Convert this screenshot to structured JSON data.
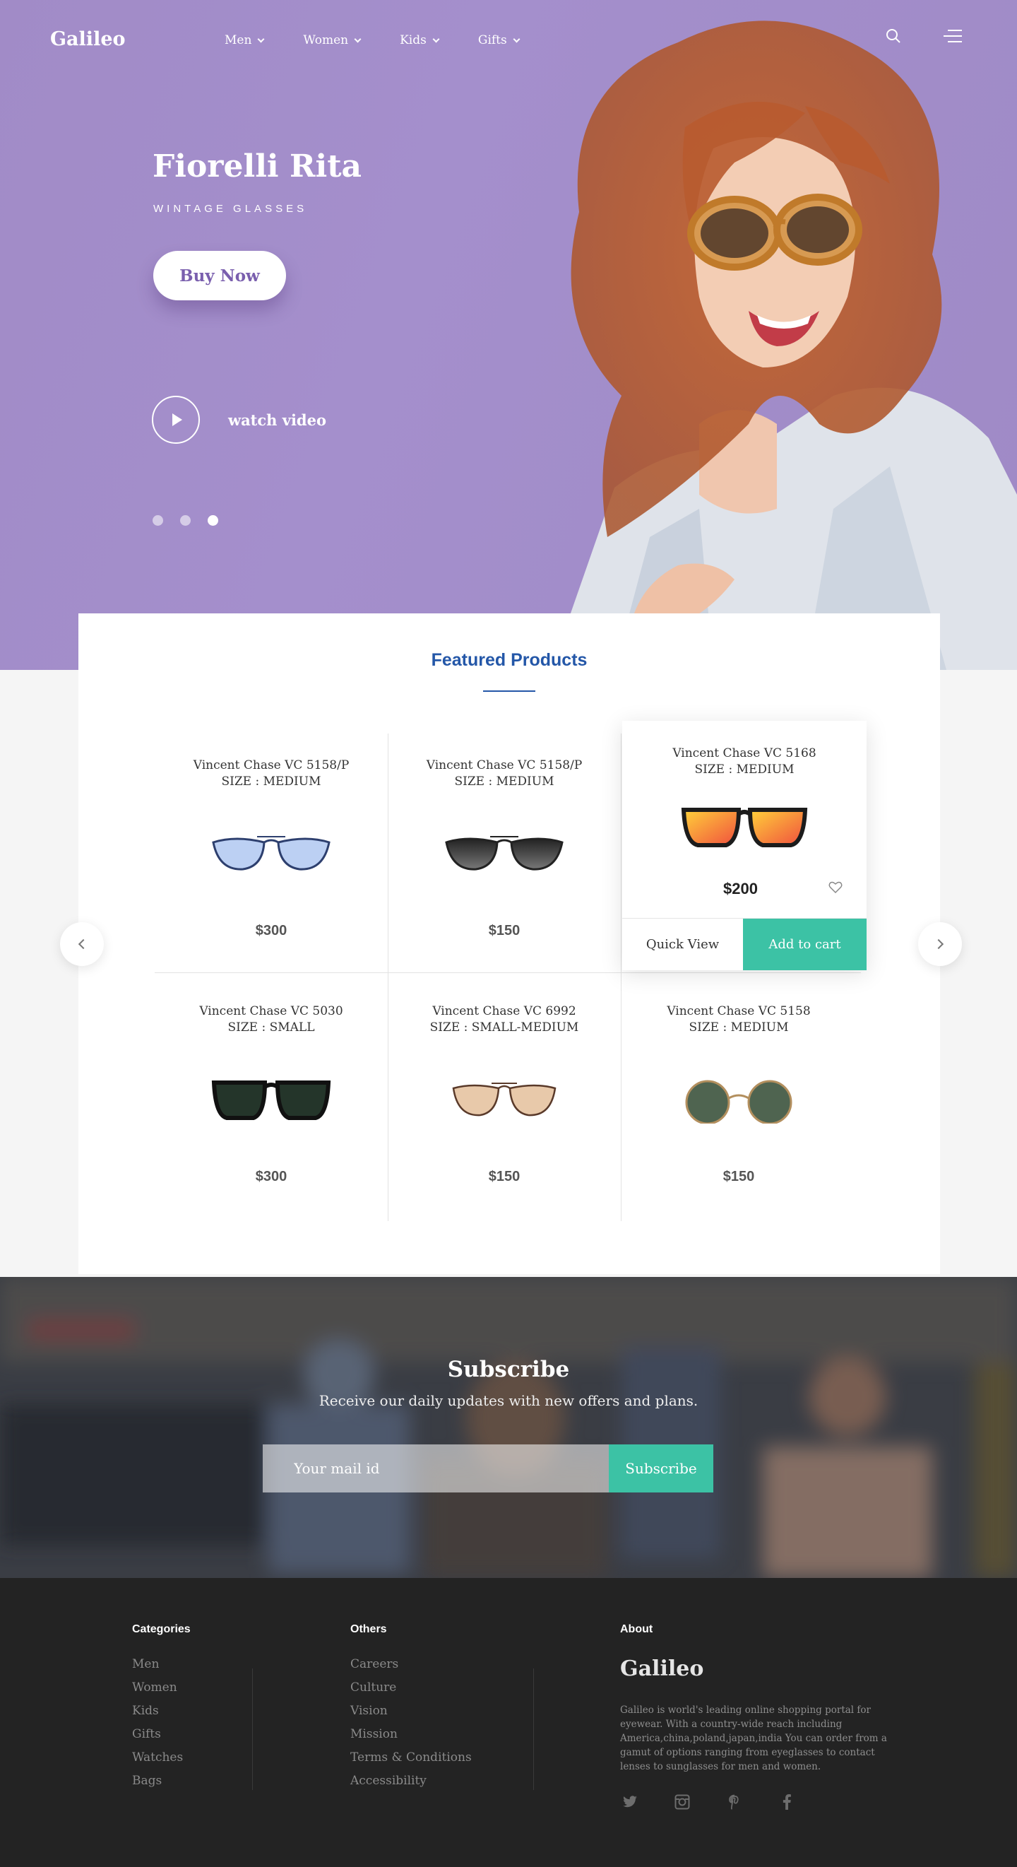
{
  "header": {
    "logo": "Galileo",
    "nav": [
      {
        "label": "Men"
      },
      {
        "label": "Women"
      },
      {
        "label": "Kids"
      },
      {
        "label": "Gifts"
      }
    ]
  },
  "hero": {
    "title": "Fiorelli Rita",
    "subtitle": "WINTAGE GLASSES",
    "cta": "Buy Now",
    "video_label": "watch video",
    "slides_total": 3,
    "active_slide": 3
  },
  "featured": {
    "title": "Featured Products",
    "products": [
      {
        "name": "Vincent Chase VC 5158/P",
        "size": "SIZE : MEDIUM",
        "price": "$300",
        "lens": "#bcd0f3",
        "frame": "#2d3f6e"
      },
      {
        "name": "Vincent Chase VC 5158/P",
        "size": "SIZE : MEDIUM",
        "price": "$150",
        "lens": "#3a3a3a",
        "frame": "#222222"
      },
      {
        "name": "Vincent Chase VC 5168",
        "size": "SIZE : MEDIUM",
        "price": "$200",
        "lens": "#f7873a",
        "frame": "#1c1c1c"
      },
      {
        "name": "Vincent Chase VC 5030",
        "size": "SIZE : SMALL",
        "price": "$300",
        "lens": "#24352a",
        "frame": "#111111"
      },
      {
        "name": "Vincent Chase VC 6992",
        "size": "SIZE : SMALL-MEDIUM",
        "price": "$150",
        "lens": "#e8c9aa",
        "frame": "#5a3a2a"
      },
      {
        "name": "Vincent Chase VC 5158",
        "size": "SIZE : MEDIUM",
        "price": "$150",
        "lens": "#4f6450",
        "frame": "#b38f5e"
      }
    ],
    "quick_view": "Quick View",
    "add_to_cart": "Add to cart"
  },
  "subscribe": {
    "title": "Subscribe",
    "text": "Receive our daily updates with new offers and plans.",
    "placeholder": "Your mail id",
    "button": "Subscribe"
  },
  "footer": {
    "categories_title": "Categories",
    "categories": [
      "Men",
      "Women",
      "Kids",
      "Gifts",
      "Watches",
      "Bags"
    ],
    "others_title": "Others",
    "others": [
      "Careers",
      "Culture",
      "Vision",
      "Mission",
      "Terms & Conditions",
      "Accessibility"
    ],
    "about_title": "About",
    "about_logo": "Galileo",
    "about_text": "Galileo is world's leading online shopping portal for eyewear. With a country-wide reach including America,china,poland,japan,india You can order from a gamut of options ranging from eyeglasses to contact lenses to sunglasses for men and women.",
    "social": [
      "twitter-icon",
      "instagram-icon",
      "pinterest-icon",
      "facebook-icon"
    ]
  },
  "colors": {
    "hero_bg": "#a48fcc",
    "accent": "#3cc2a5",
    "featured_title": "#2457a8",
    "footer_bg": "#232323"
  }
}
